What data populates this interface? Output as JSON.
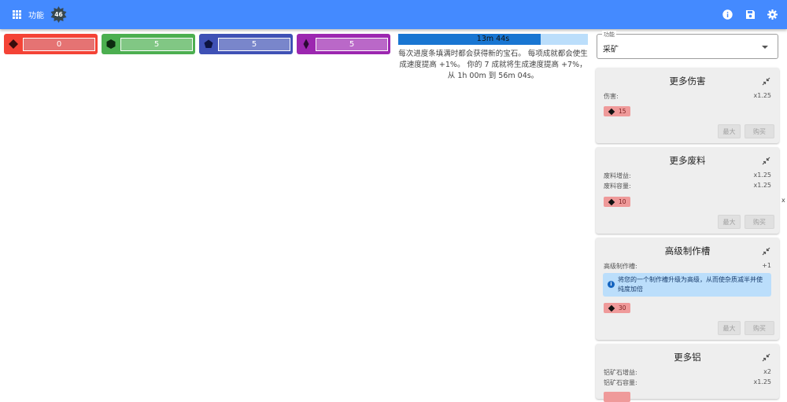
{
  "topbar": {
    "menu_label": "功能",
    "badge_count": "46",
    "icons": [
      "info-icon",
      "save-icon",
      "settings-icon"
    ],
    "color": "#448aff"
  },
  "gems": [
    {
      "name": "red",
      "shape": "diamond",
      "value": "0",
      "color": "#f44336",
      "fill": "#e57373"
    },
    {
      "name": "green",
      "shape": "hexagon",
      "value": "5",
      "color": "#4caf50",
      "fill": "#81c784"
    },
    {
      "name": "blue",
      "shape": "pentagon",
      "value": "5",
      "color": "#3f51b5",
      "fill": "#7986cb"
    },
    {
      "name": "purple",
      "shape": "rhombus",
      "value": "5",
      "color": "#9c27b0",
      "fill": "#ba68c8"
    }
  ],
  "progress": {
    "text": "13m 44s",
    "fraction": 0.75
  },
  "description": "每次进度条填满时都会获得新的宝石。 每项成就都会使生成速度提高 +1%。 你的 7 成就将生成速度提高 +7%，从 1h 00m 到 56m 04s。",
  "feature_select": {
    "label": "功能",
    "value": "采矿"
  },
  "upgrades": [
    {
      "title": "更多伤害",
      "stats": [
        {
          "k": "伤害:",
          "v": "x1.25"
        }
      ],
      "cost": "15",
      "max_label": "最大",
      "buy_label": "购买"
    },
    {
      "title": "更多废料",
      "stats": [
        {
          "k": "废料增益:",
          "v": "x1.25"
        },
        {
          "k": "废料容量:",
          "v": "x1.25"
        }
      ],
      "cost": "10",
      "max_label": "最大",
      "buy_label": "购买"
    },
    {
      "title": "高级制作槽",
      "stats": [
        {
          "k": "高级制作槽:",
          "v": "+1"
        }
      ],
      "info": "将您的一个制作槽升级为高级，从而使杂质减半并使纯度加倍",
      "cost": "30",
      "max_label": "最大",
      "buy_label": "购买"
    },
    {
      "title": "更多铝",
      "stats": [
        {
          "k": "铝矿石增益:",
          "v": "x2"
        },
        {
          "k": "铝矿石容量:",
          "v": "x1.25"
        }
      ]
    }
  ],
  "scroll_marker": "x"
}
